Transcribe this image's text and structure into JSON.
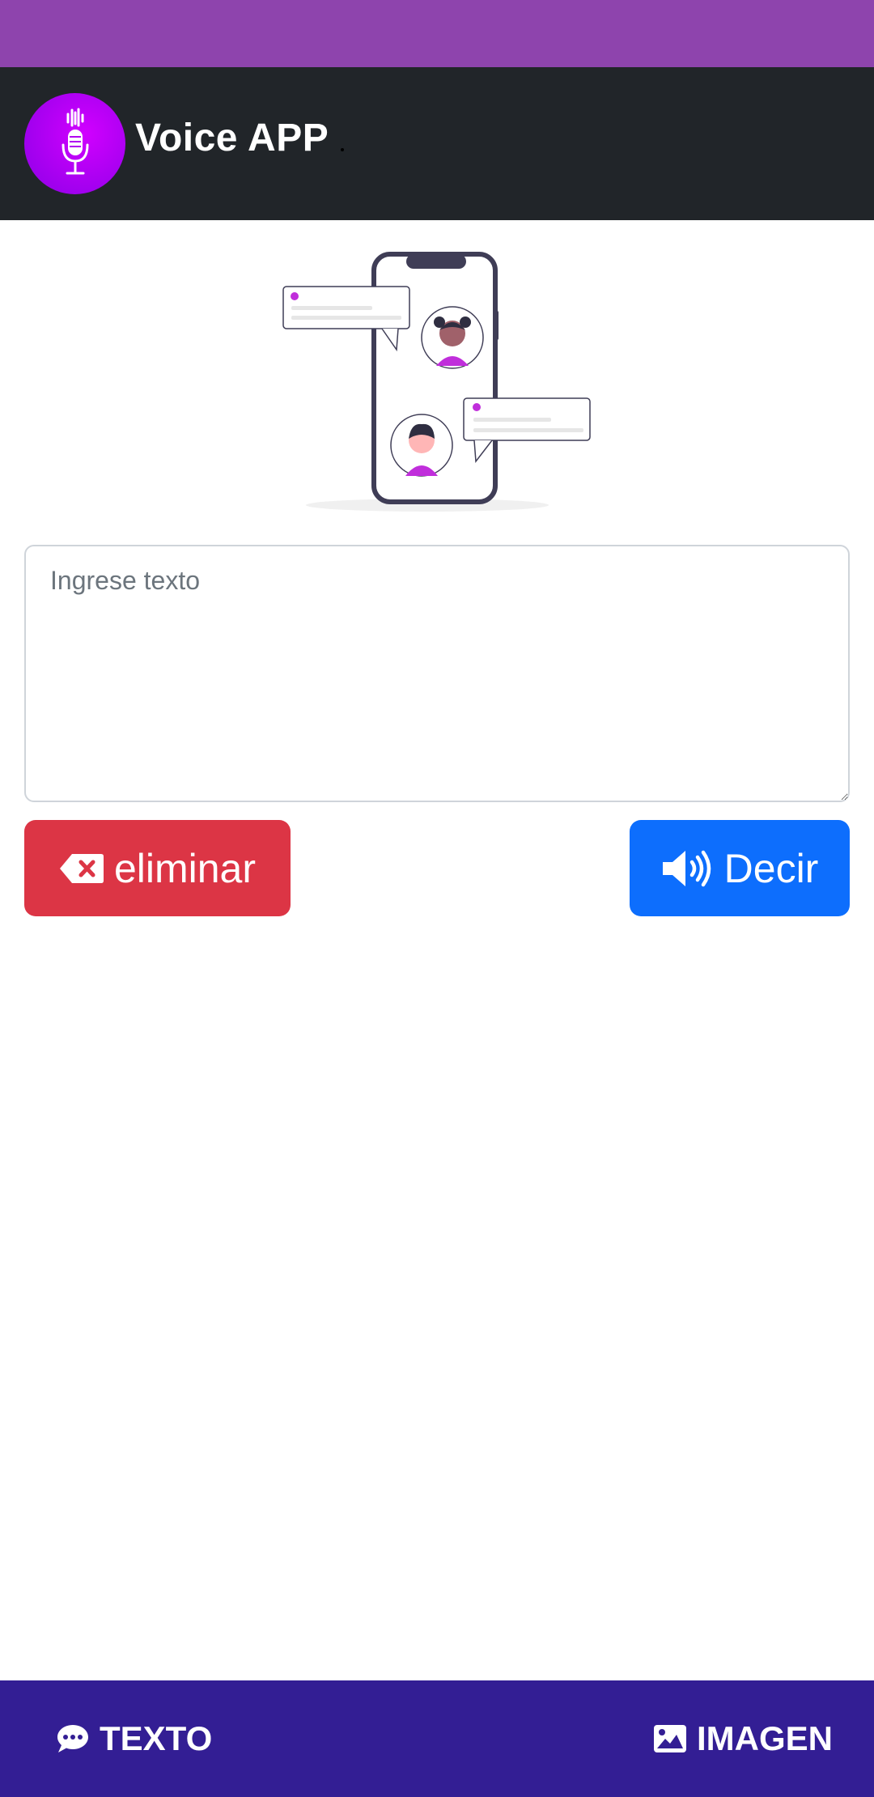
{
  "app": {
    "title": "Voice APP",
    "logo_icon": "microphone-icon"
  },
  "input": {
    "placeholder": "Ingrese texto",
    "value": ""
  },
  "actions": {
    "delete_label": "eliminar",
    "delete_icon": "backspace-icon",
    "delete_color": "#dc3545",
    "say_label": "Decir",
    "say_icon": "volume-high-icon",
    "say_color": "#0d6efd"
  },
  "bottom_nav": {
    "items": [
      {
        "label": "TEXTO",
        "icon": "comment-icon"
      },
      {
        "label": "IMAGEN",
        "icon": "image-icon"
      }
    ],
    "background": "#331e94"
  },
  "colors": {
    "status_bar": "#8e44ad",
    "app_bar": "#212529",
    "accent": "#c02edb"
  }
}
